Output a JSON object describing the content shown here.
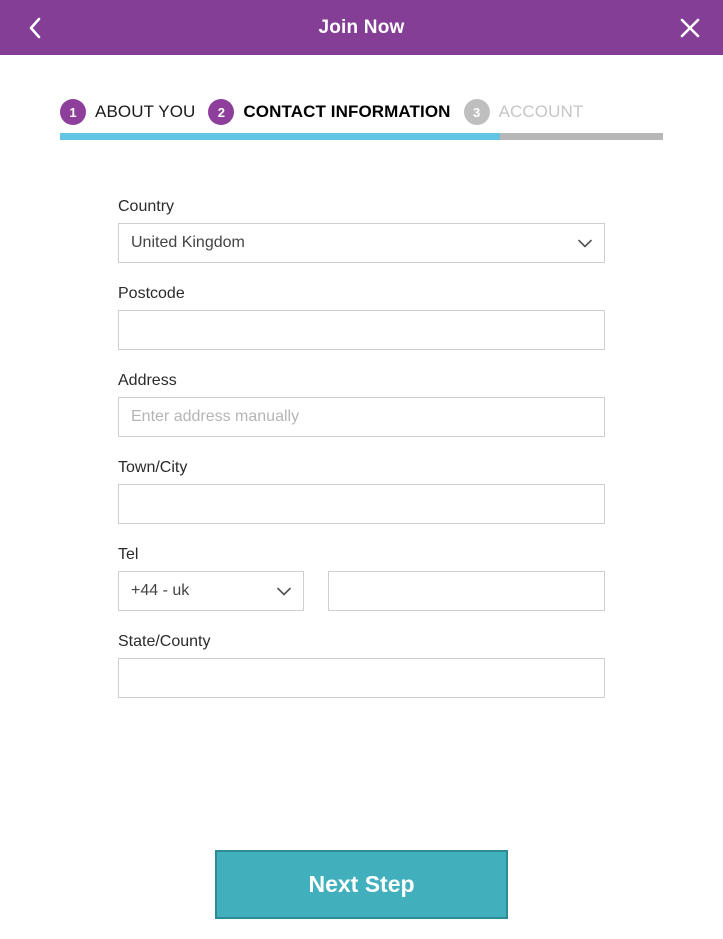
{
  "header": {
    "title": "Join Now",
    "back_icon": "chevron-left-icon",
    "close_icon": "close-icon"
  },
  "steps": {
    "items": [
      {
        "number": "1",
        "label": "ABOUT YOU",
        "state": "done"
      },
      {
        "number": "2",
        "label": "CONTACT INFORMATION",
        "state": "active"
      },
      {
        "number": "3",
        "label": "ACCOUNT",
        "state": "todo"
      }
    ],
    "progress_percent": 73,
    "progress_fill_color": "#63C4E3",
    "progress_track_color": "#B7B7B7"
  },
  "form": {
    "country": {
      "label": "Country",
      "value": "United Kingdom",
      "icon": "chevron-down-icon"
    },
    "postcode": {
      "label": "Postcode",
      "value": "",
      "placeholder": ""
    },
    "address": {
      "label": "Address",
      "value": "",
      "placeholder": "Enter address manually"
    },
    "town_city": {
      "label": "Town/City",
      "value": "",
      "placeholder": ""
    },
    "tel": {
      "label": "Tel",
      "dial_code_value": "+44 - uk",
      "dial_code_icon": "chevron-down-icon",
      "number_value": "",
      "number_placeholder": ""
    },
    "state_county": {
      "label": "State/County",
      "value": "",
      "placeholder": ""
    }
  },
  "footer": {
    "next_label": "Next Step"
  },
  "colors": {
    "brand_purple": "#843E96",
    "step_purple": "#8E3E9B",
    "accent_teal": "#41B0BC",
    "accent_teal_border": "#2C8B96",
    "progress_cyan": "#63C4E3",
    "muted_grey": "#BFBFBF"
  }
}
